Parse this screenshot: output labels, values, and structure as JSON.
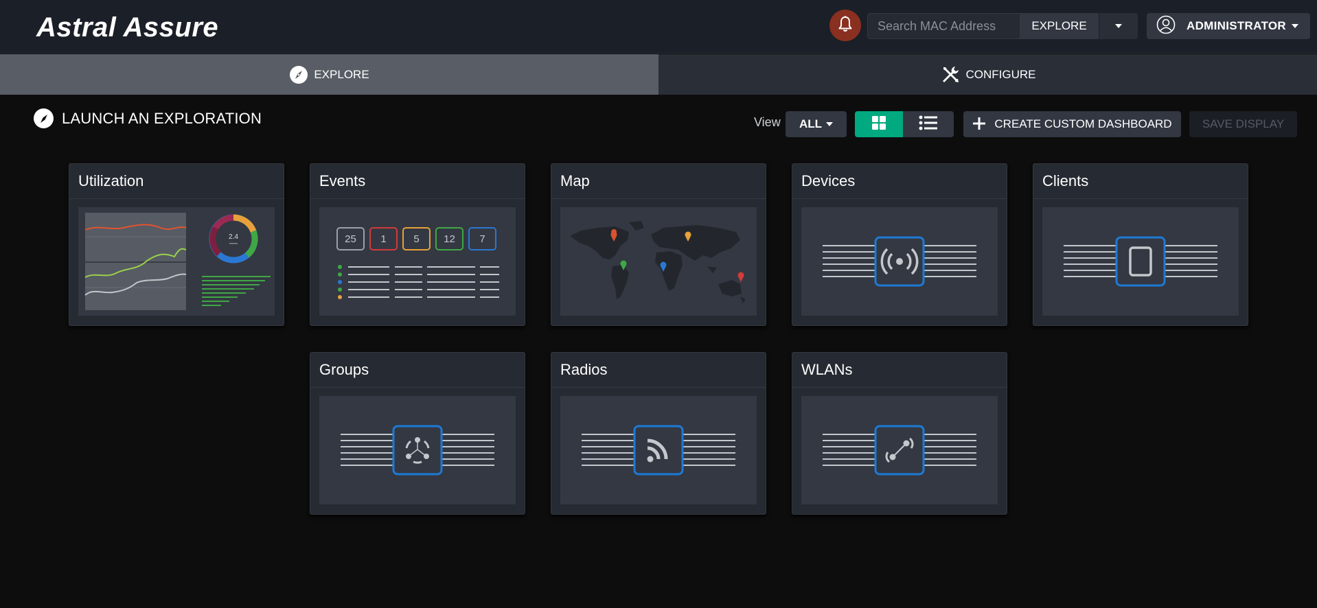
{
  "app": {
    "title": "Astral Assure"
  },
  "header": {
    "search_placeholder": "Search MAC Address",
    "explore_label": "EXPLORE",
    "user_label": "ADMINISTRATOR"
  },
  "tabs": [
    {
      "label": "EXPLORE",
      "active": true
    },
    {
      "label": "CONFIGURE",
      "active": false
    }
  ],
  "toolbar": {
    "heading": "LAUNCH AN EXPLORATION",
    "view_label": "View",
    "view_value": "ALL",
    "custom_dashboard_label": "CREATE CUSTOM DASHBOARD",
    "save_display_label": "SAVE DISPLAY"
  },
  "cards": [
    {
      "title": "Utilization"
    },
    {
      "title": "Events"
    },
    {
      "title": "Map"
    },
    {
      "title": "Devices"
    },
    {
      "title": "Clients"
    },
    {
      "title": "Groups"
    },
    {
      "title": "Radios"
    },
    {
      "title": "WLANs"
    }
  ],
  "utilization_preview": {
    "donut_value": "2.4"
  },
  "events_preview": {
    "counts": [
      {
        "value": "25",
        "color": "#9aa0a8"
      },
      {
        "value": "1",
        "color": "#d23b3b"
      },
      {
        "value": "5",
        "color": "#e8a13a"
      },
      {
        "value": "12",
        "color": "#3fa845"
      },
      {
        "value": "7",
        "color": "#2a78d2"
      }
    ]
  },
  "colors": {
    "accent_green": "#00a97f",
    "icon_blue": "#1d7ad6",
    "bell_bg": "#8a3020"
  },
  "icons": {
    "bell": "bell-icon",
    "compass": "compass-icon",
    "tools": "tools-icon",
    "grid": "grid-icon",
    "list": "list-icon",
    "user": "user-circle-icon"
  }
}
